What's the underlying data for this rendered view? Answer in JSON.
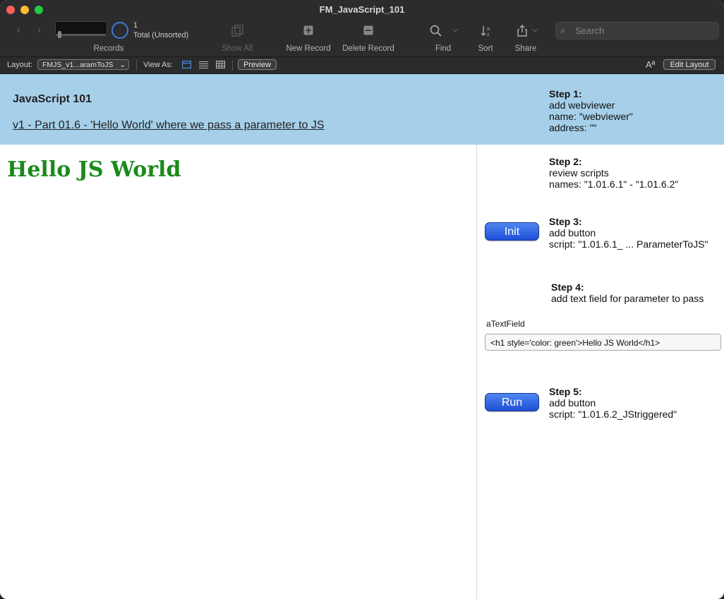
{
  "window": {
    "title": "FM_JavaScript_101"
  },
  "toolbar": {
    "record_count": "1",
    "record_total": "Total (Unsorted)",
    "records_label": "Records",
    "show_all_label": "Show All",
    "new_record_label": "New Record",
    "delete_record_label": "Delete Record",
    "find_label": "Find",
    "sort_label": "Sort",
    "share_label": "Share",
    "search_placeholder": "Search"
  },
  "layout_bar": {
    "layout_label": "Layout:",
    "layout_value": "FMJS_v1...aramToJS",
    "view_as_label": "View As:",
    "preview_label": "Preview",
    "edit_layout_label": "Edit Layout",
    "font_icon_text": "Aª"
  },
  "header": {
    "title": "JavaScript 101",
    "subtitle": "v1 - Part 01.6 - 'Hello World' where we pass a parameter to JS"
  },
  "webviewer": {
    "content": "Hello JS World"
  },
  "steps": [
    {
      "title": "Step 1:",
      "lines": [
        "add webviewer",
        "name: \"webviewer\"",
        "address: \"\""
      ]
    },
    {
      "title": "Step 2:",
      "lines": [
        "review scripts",
        "names: \"1.01.6.1\" - \"1.01.6.2\""
      ]
    },
    {
      "title": "Step 3:",
      "lines": [
        "add button",
        "script: \"1.01.6.1_ ... ParameterToJS\""
      ]
    },
    {
      "title": "Step 4:",
      "lines": [
        "add text field for parameter to pass"
      ]
    },
    {
      "title": "Step 5:",
      "lines": [
        "add button",
        "script: \"1.01.6.2_JStriggered\""
      ]
    }
  ],
  "buttons": {
    "init": "Init",
    "run": "Run"
  },
  "field": {
    "label": "aTextField",
    "value": "<h1 style='color: green'>Hello JS World</h1>"
  }
}
